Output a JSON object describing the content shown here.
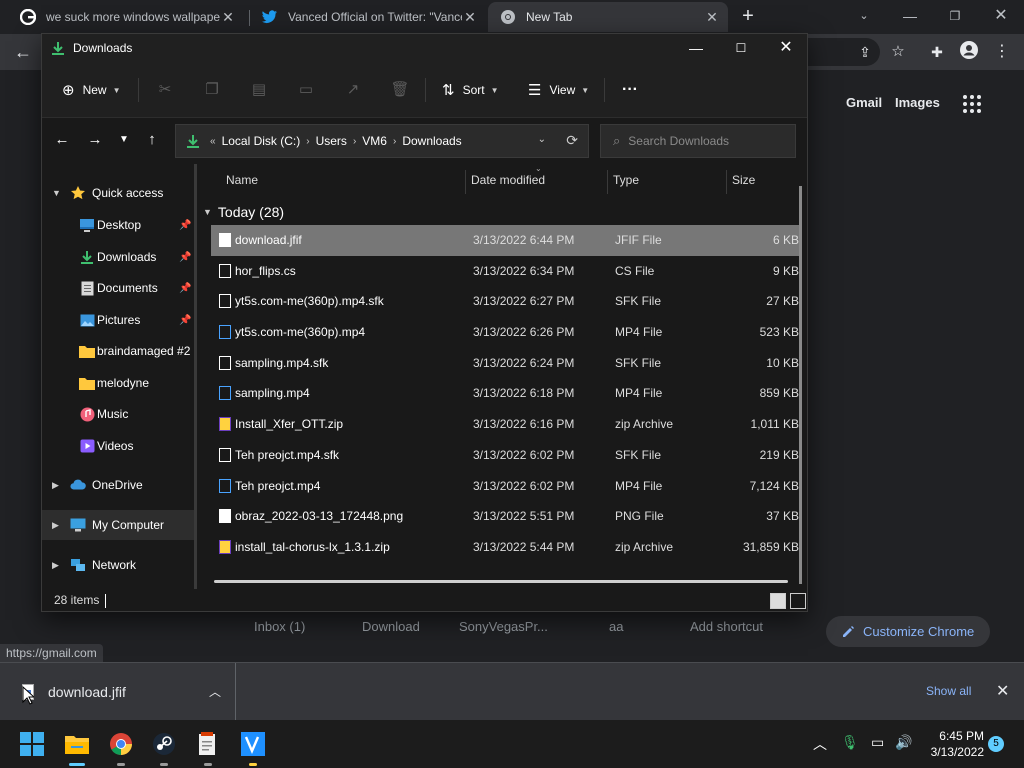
{
  "chrome": {
    "tabs": [
      {
        "title": "we suck more windows wallpapers",
        "icon": "google-icon"
      },
      {
        "title": "Vanced Official on Twitter: \"Vanced...",
        "icon": "twitter-icon"
      },
      {
        "title": "New Tab",
        "icon": "chrome-icon"
      }
    ],
    "links": {
      "gmail": "Gmail",
      "images": "Images"
    },
    "shortcuts": [
      "Inbox (1)",
      "Download",
      "SonyVegasPr...",
      "aa",
      "Add shortcut"
    ],
    "customize_label": "Customize Chrome",
    "status_url": "https://gmail.com"
  },
  "download_shelf": {
    "file_name": "download.jfif",
    "show_all": "Show all"
  },
  "explorer": {
    "title": "Downloads",
    "commands": {
      "new": "New",
      "sort": "Sort",
      "view": "View",
      "more": "···"
    },
    "breadcrumb": [
      "Local Disk (C:)",
      "Users",
      "VM6",
      "Downloads"
    ],
    "search_placeholder": "Search Downloads",
    "sidebar": {
      "quick_access": "Quick access",
      "items": [
        {
          "label": "Desktop",
          "icon": "desktop-icon",
          "pinned": true
        },
        {
          "label": "Downloads",
          "icon": "download-icon",
          "pinned": true
        },
        {
          "label": "Documents",
          "icon": "documents-icon",
          "pinned": true
        },
        {
          "label": "Pictures",
          "icon": "pictures-icon",
          "pinned": true
        },
        {
          "label": "braindamaged #2",
          "icon": "folder-icon",
          "pinned": false
        },
        {
          "label": "melodyne",
          "icon": "folder-icon",
          "pinned": false
        },
        {
          "label": "Music",
          "icon": "music-icon",
          "pinned": false
        },
        {
          "label": "Videos",
          "icon": "videos-icon",
          "pinned": false
        }
      ],
      "onedrive": "OneDrive",
      "my_computer": "My Computer",
      "network": "Network"
    },
    "columns": {
      "name": "Name",
      "date": "Date modified",
      "type": "Type",
      "size": "Size"
    },
    "group": "Today (28)",
    "files": [
      {
        "name": "download.jfif",
        "date": "3/13/2022 6:44 PM",
        "type": "JFIF File",
        "size": "6 KB",
        "kind": "image"
      },
      {
        "name": "hor_flips.cs",
        "date": "3/13/2022 6:34 PM",
        "type": "CS File",
        "size": "9 KB",
        "kind": "doc"
      },
      {
        "name": "yt5s.com-me(360p).mp4.sfk",
        "date": "3/13/2022 6:27 PM",
        "type": "SFK File",
        "size": "27 KB",
        "kind": "doc"
      },
      {
        "name": "yt5s.com-me(360p).mp4",
        "date": "3/13/2022 6:26 PM",
        "type": "MP4 File",
        "size": "523 KB",
        "kind": "media"
      },
      {
        "name": "sampling.mp4.sfk",
        "date": "3/13/2022 6:24 PM",
        "type": "SFK File",
        "size": "10 KB",
        "kind": "doc"
      },
      {
        "name": "sampling.mp4",
        "date": "3/13/2022 6:18 PM",
        "type": "MP4 File",
        "size": "859 KB",
        "kind": "media"
      },
      {
        "name": "Install_Xfer_OTT.zip",
        "date": "3/13/2022 6:16 PM",
        "type": "zip Archive",
        "size": "1,011 KB",
        "kind": "zip"
      },
      {
        "name": "Teh preojct.mp4.sfk",
        "date": "3/13/2022 6:02 PM",
        "type": "SFK File",
        "size": "219 KB",
        "kind": "doc"
      },
      {
        "name": "Teh preojct.mp4",
        "date": "3/13/2022 6:02 PM",
        "type": "MP4 File",
        "size": "7,124 KB",
        "kind": "media"
      },
      {
        "name": "obraz_2022-03-13_172448.png",
        "date": "3/13/2022 5:51 PM",
        "type": "PNG File",
        "size": "37 KB",
        "kind": "image"
      },
      {
        "name": "install_tal-chorus-lx_1.3.1.zip",
        "date": "3/13/2022 5:44 PM",
        "type": "zip Archive",
        "size": "31,859 KB",
        "kind": "zip"
      }
    ],
    "status": "28 items"
  },
  "taskbar": {
    "time": "6:45 PM",
    "date": "3/13/2022",
    "notifications": "5"
  },
  "colors": {
    "accent": "#60cdff",
    "link": "#8ab4f8",
    "selection": "#777777"
  }
}
